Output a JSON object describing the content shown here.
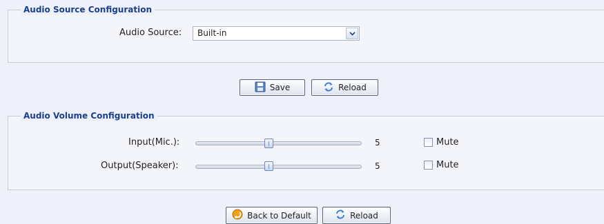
{
  "audio_source_section": {
    "legend": "Audio Source Configuration",
    "source_label": "Audio Source:",
    "source_value": "Built-in"
  },
  "source_buttons": {
    "save_label": "Save",
    "reload_label": "Reload"
  },
  "audio_volume_section": {
    "legend": "Audio Volume Configuration",
    "input": {
      "label": "Input(Mic.):",
      "value": "5",
      "level": 0.5,
      "mute_label": "Mute",
      "mute_checked": false
    },
    "output": {
      "label": "Output(Speaker):",
      "value": "5",
      "level": 0.5,
      "mute_label": "Mute",
      "mute_checked": false
    }
  },
  "volume_buttons": {
    "back_to_default_label": "Back to Default",
    "reload_label": "Reload"
  },
  "icons": {
    "save": "floppy-disk-icon",
    "reload": "refresh-arrows-icon",
    "back_to_default": "back-arrow-icon",
    "dropdown": "chevron-down-icon"
  }
}
